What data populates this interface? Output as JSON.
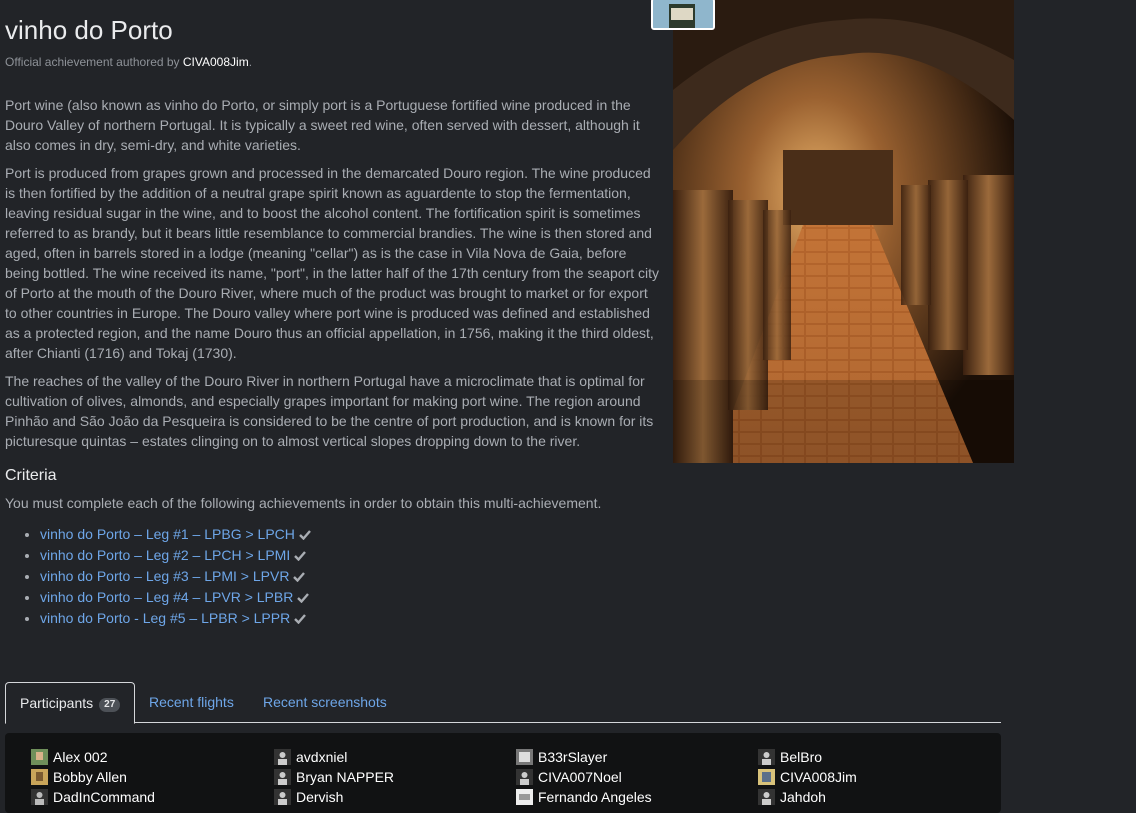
{
  "title": "vinho do Porto",
  "meta": {
    "prefix": "Official achievement authored by",
    "author": "CIVA008Jim",
    "suffix": "."
  },
  "description": [
    "Port wine (also known as vinho do Porto, or simply port is a Portuguese fortified wine produced in the Douro Valley of northern Portugal. It is typically a sweet red wine, often served with dessert, although it also comes in dry, semi-dry, and white varieties.",
    "Port is produced from grapes grown and processed in the demarcated Douro region. The wine produced is then fortified by the addition of a neutral grape spirit known as aguardente to stop the fermentation, leaving residual sugar in the wine, and to boost the alcohol content. The fortification spirit is sometimes referred to as brandy, but it bears little resemblance to commercial brandies. The wine is then stored and aged, often in barrels stored in a lodge (meaning \"cellar\") as is the case in Vila Nova de Gaia, before being bottled. The wine received its name, \"port\", in the latter half of the 17th century from the seaport city of Porto at the mouth of the Douro River, where much of the product was brought to market or for export to other countries in Europe. The Douro valley where port wine is produced was defined and established as a protected region, and the name Douro thus an official appellation, in 1756, making it the third oldest, after Chianti (1716) and Tokaj (1730).",
    "The reaches of the valley of the Douro River in northern Portugal have a microclimate that is optimal for cultivation of olives, almonds, and especially grapes important for making port wine. The region around Pinhão and São João da Pesqueira is considered to be the centre of port production, and is known for its picturesque quintas – estates clinging on to almost vertical slopes dropping down to the river."
  ],
  "criteria": {
    "heading": "Criteria",
    "intro": "You must complete each of the following achievements in order to obtain this multi-achievement.",
    "legs": [
      "vinho do Porto – Leg #1 – LPBG > LPCH",
      "vinho do Porto – Leg #2 – LPCH > LPMI",
      "vinho do Porto – Leg #3 – LPMI > LPVR",
      "vinho do Porto – Leg #4 – LPVR > LPBR",
      "vinho do Porto - Leg #5 – LPBR > LPPR"
    ]
  },
  "tabs": {
    "participants": {
      "label": "Participants",
      "count": "27"
    },
    "flights": "Recent flights",
    "screenshots": "Recent screenshots"
  },
  "participants": [
    [
      "Alex 002",
      "Bobby Allen",
      "DadInCommand"
    ],
    [
      "avdxniel",
      "Bryan NAPPER",
      "Dervish"
    ],
    [
      "B33rSlayer",
      "CIVA007Noel",
      "Fernando Angeles"
    ],
    [
      "BelBro",
      "CIVA008Jim",
      "Jahdoh"
    ]
  ],
  "colors": {
    "background": "#222428",
    "link": "#6ea6e8",
    "panel": "#111213",
    "text": "#a9adb3"
  }
}
